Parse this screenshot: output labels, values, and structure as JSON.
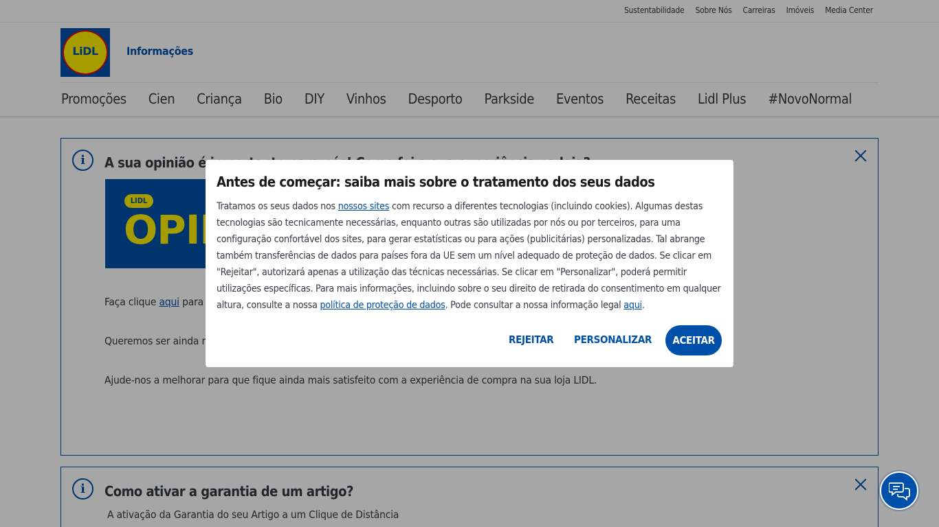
{
  "utility_nav": [
    "Sustentabilidade",
    "Sobre Nós",
    "Carreiras",
    "Imóveis",
    "Media Center"
  ],
  "logo_text": "LiDL",
  "header_title": "Informações",
  "main_nav": [
    "Promoções",
    "Cien",
    "Criança",
    "Bio",
    "DIY",
    "Vinhos",
    "Desporto",
    "Parkside",
    "Eventos",
    "Receitas",
    "Lidl Plus",
    "#NovoNormal"
  ],
  "box1": {
    "title": "A sua opinião é importante para nós! Como foi a sua experiência na loja?",
    "banner_badge": "LIDL",
    "banner_text": "OPINIÃO",
    "para1_prefix": "Faça clique ",
    "para1_link": "aqui",
    "para1_suffix": " para",
    "para2": "Queremos ser ainda m",
    "para3": "Ajude-nos a melhorar para que fique ainda mais satisfeito com a experiência de compra na sua loja LIDL."
  },
  "box2": {
    "title": "Como ativar a garantia de um artigo?",
    "para1": "A ativação da Garantia do seu Artigo a um Clique de Distância"
  },
  "modal": {
    "title": "Antes de começar: saiba mais sobre o tratamento dos seus dados",
    "body_1": "Tratamos os seus dados nos ",
    "link_sites": "nossos sites",
    "body_2": " com recurso a diferentes tecnologias (incluindo cookies). Algumas destas tecnologias são tecnicamente necessárias, enquanto outras são utilizadas por nós ou por terceiros, para uma configuração confortável dos sites, para gerar estatísticas ou para ações (publicitárias) personalizadas. Tal abrange também transferências de dados para países fora da UE sem um nível adequado de proteção de dados. Se clicar em \"Rejeitar\", autorizará apenas a utilização das técnicas necessárias. Se clicar em \"Personalizar\", poderá permitir utilizações específicas. Para mais informações, incluindo sobre o seu direito de retirada do consentimento em qualquer altura, consulte a nossa ",
    "link_policy": "política de proteção de dados",
    "body_3": ". Pode consultar a nossa informação legal ",
    "link_legal": "aqui",
    "body_4": ".",
    "reject_label": "REJEITAR",
    "customize_label": "PERSONALIZAR",
    "accept_label": "ACEITAR"
  },
  "colors": {
    "brand_blue": "#0050aa",
    "brand_yellow": "#fff000",
    "brand_red": "#e60a14"
  }
}
